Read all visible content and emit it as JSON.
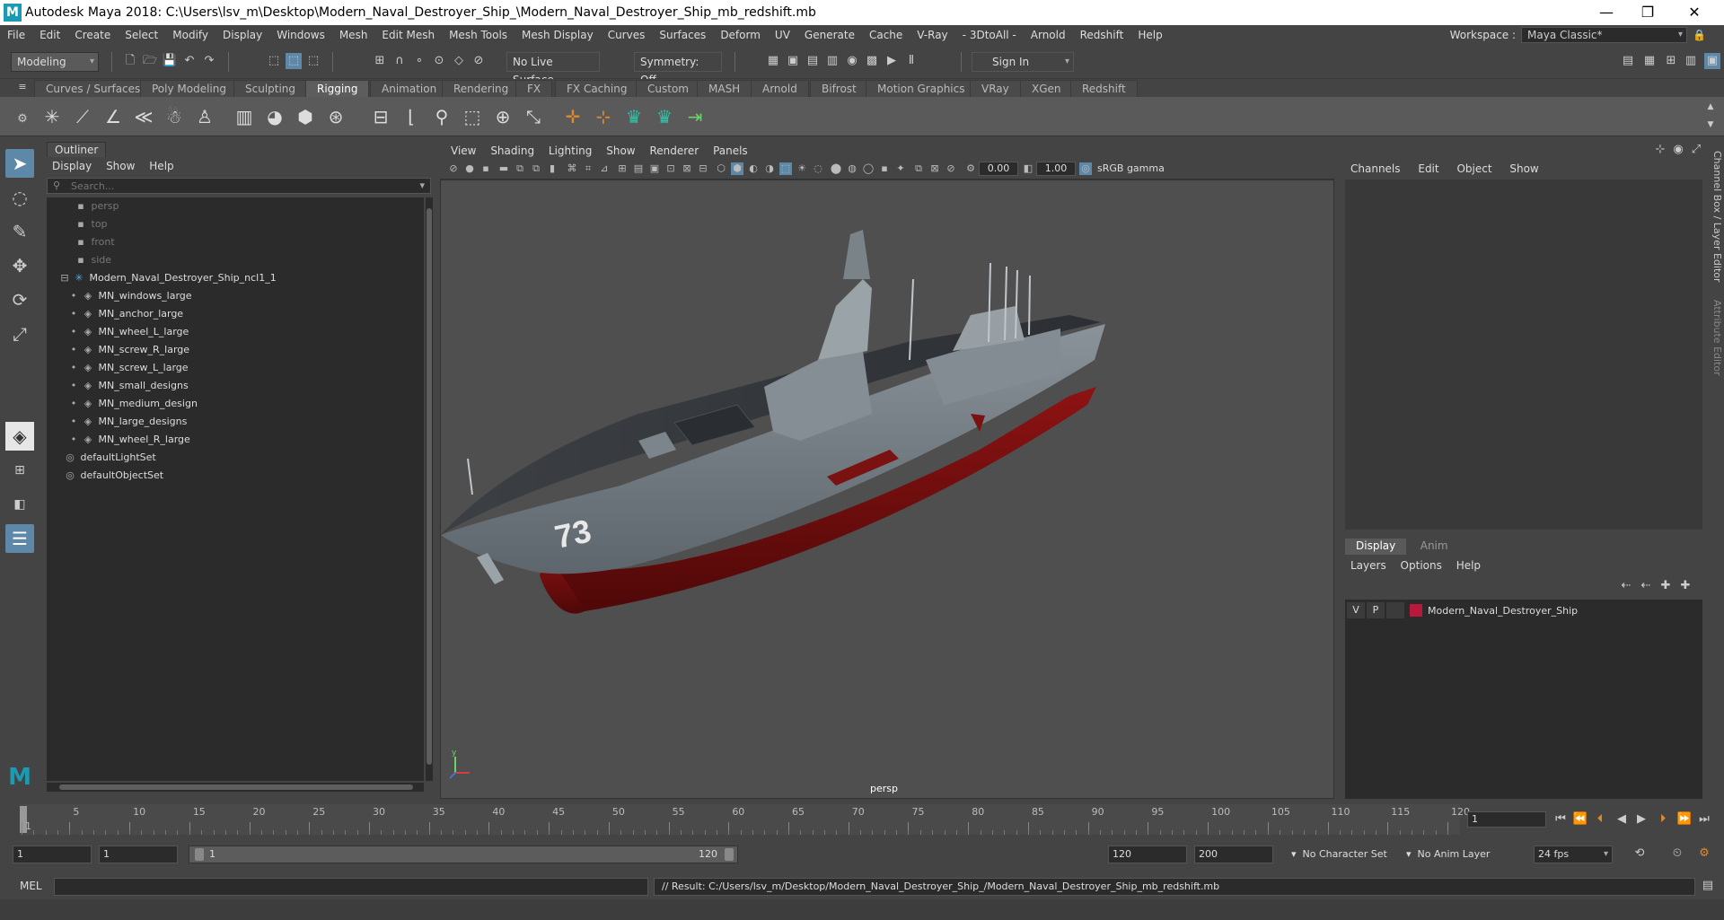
{
  "window": {
    "title": "Autodesk Maya 2018: C:\\Users\\lsv_m\\Desktop\\Modern_Naval_Destroyer_Ship_\\Modern_Naval_Destroyer_Ship_mb_redshift.mb",
    "logo_letter": "M",
    "minimize": "—",
    "maximize": "❐",
    "close": "✕"
  },
  "menu": {
    "items": [
      "File",
      "Edit",
      "Create",
      "Select",
      "Modify",
      "Display",
      "Windows",
      "Mesh",
      "Edit Mesh",
      "Mesh Tools",
      "Mesh Display",
      "Curves",
      "Surfaces",
      "Deform",
      "UV",
      "Generate",
      "Cache",
      "V-Ray",
      "- 3DtoAll -",
      "Arnold",
      "Redshift",
      "Help"
    ],
    "workspace_label": "Workspace :",
    "workspace_value": "Maya Classic*"
  },
  "statusline": {
    "mode": "Modeling",
    "live_surface": "No Live Surface",
    "symmetry": "Symmetry: Off",
    "sign_in": "Sign In"
  },
  "shelf": {
    "tabs": [
      "Curves / Surfaces",
      "Poly Modeling",
      "Sculpting",
      "Rigging",
      "Animation",
      "Rendering",
      "FX",
      "FX Caching",
      "Custom",
      "MASH",
      "Arnold",
      "Bifrost",
      "Motion Graphics",
      "VRay",
      "XGen",
      "Redshift"
    ],
    "active_tab": "Rigging"
  },
  "outliner": {
    "title": "Outliner",
    "menu": [
      "Display",
      "Show",
      "Help"
    ],
    "search_placeholder": "Search...",
    "cameras": [
      "persp",
      "top",
      "front",
      "side"
    ],
    "group": "Modern_Naval_Destroyer_Ship_ncl1_1",
    "children": [
      "MN_windows_large",
      "MN_anchor_large",
      "MN_wheel_L_large",
      "MN_screw_R_large",
      "MN_screw_L_large",
      "MN_small_designs",
      "MN_medium_design",
      "MN_large_designs",
      "MN_wheel_R_large"
    ],
    "sets": [
      "defaultLightSet",
      "defaultObjectSet"
    ]
  },
  "viewport": {
    "menu": [
      "View",
      "Shading",
      "Lighting",
      "Show",
      "Renderer",
      "Panels"
    ],
    "exposure": "0.00",
    "gamma": "1.00",
    "color_space": "sRGB gamma",
    "camera": "persp",
    "hull_number": "73",
    "axis_y": "y"
  },
  "channelbox": {
    "menu": [
      "Channels",
      "Edit",
      "Object",
      "Show"
    ],
    "side_tab_1": "Channel Box / Layer Editor",
    "side_tab_2": "Attribute Editor"
  },
  "layers": {
    "tabs": [
      "Display",
      "Anim"
    ],
    "active_tab": "Display",
    "menu": [
      "Layers",
      "Options",
      "Help"
    ],
    "row": {
      "v": "V",
      "p": "P",
      "name": "Modern_Naval_Destroyer_Ship",
      "color": "#b8193b"
    }
  },
  "timeline": {
    "ticks": [
      "1",
      "5",
      "10",
      "15",
      "20",
      "25",
      "30",
      "35",
      "40",
      "45",
      "50",
      "55",
      "60",
      "65",
      "70",
      "75",
      "80",
      "85",
      "90",
      "95",
      "100",
      "105",
      "110",
      "115",
      "120"
    ],
    "current_frame": "1"
  },
  "range": {
    "start": "1",
    "playback_start": "1",
    "slider_start": "1",
    "slider_end": "120",
    "playback_end": "120",
    "end": "200",
    "character_set": "No Character Set",
    "anim_layer": "No Anim Layer",
    "fps": "24 fps"
  },
  "command": {
    "label": "MEL",
    "result": "// Result: C:/Users/lsv_m/Desktop/Modern_Naval_Destroyer_Ship_/Modern_Naval_Destroyer_Ship_mb_redshift.mb"
  }
}
